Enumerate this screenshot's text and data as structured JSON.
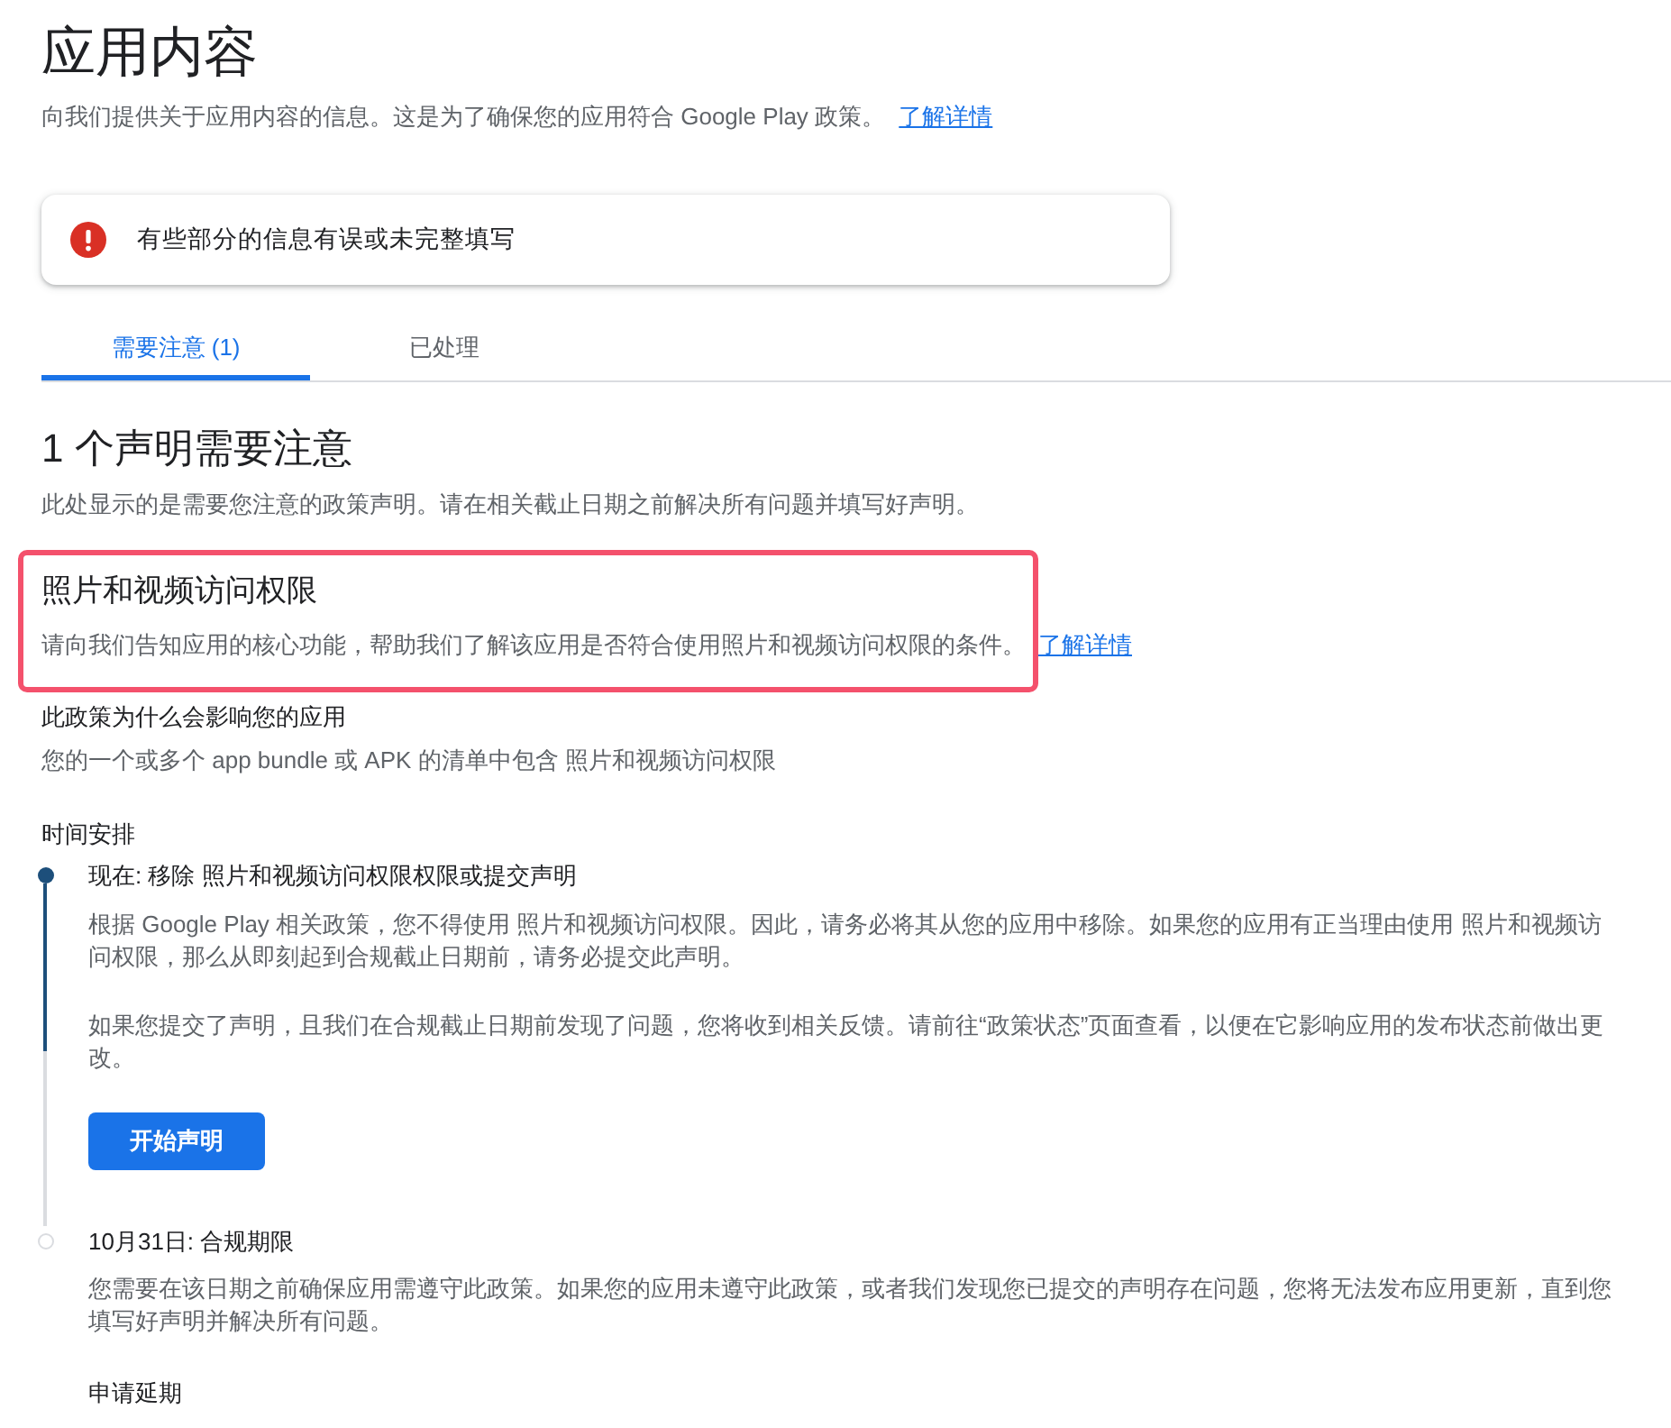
{
  "page": {
    "title": "应用内容",
    "subtitle": "向我们提供关于应用内容的信息。这是为了确保您的应用符合 Google Play 政策。",
    "subtitle_link": "了解详情"
  },
  "alert": {
    "kind": "error",
    "message": "有些部分的信息有误或未完整填写"
  },
  "tabs": [
    {
      "label": "需要注意 (1)",
      "selected": true
    },
    {
      "label": "已处理",
      "selected": false
    }
  ],
  "section": {
    "heading": "1 个声明需要注意",
    "description": "此处显示的是需要您注意的政策声明。请在相关截止日期之前解决所有问题并填写好声明。"
  },
  "declaration": {
    "title": "照片和视频访问权限",
    "description": "请向我们告知应用的核心功能，帮助我们了解该应用是否符合使用照片和视频访问权限的条件。",
    "link": "了解详情",
    "highlighted": true
  },
  "policy_impact": {
    "heading": "此政策为什么会影响您的应用",
    "text": "您的一个或多个 app bundle 或 APK 的清单中包含 照片和视频访问权限"
  },
  "timeline": {
    "heading": "时间安排",
    "items": [
      {
        "title": "现在: 移除 照片和视频访问权限权限或提交声明",
        "current": true,
        "paragraphs": [
          "根据 Google Play 相关政策，您不得使用 照片和视频访问权限。因此，请务必将其从您的应用中移除。如果您的应用有正当理由使用 照片和视频访问权限，那么从即刻起到合规截止日期前，请务必提交此声明。",
          "如果您提交了声明，且我们在合规截止日期前发现了问题，您将收到相关反馈。请前往“政策状态”页面查看，以便在它影响应用的发布状态前做出更改。"
        ],
        "button": "开始声明"
      },
      {
        "title": "10月31日: 合规期限",
        "current": false,
        "paragraphs": [
          "您需要在该日期之前确保应用需遵守此政策。如果您的应用未遵守此政策，或者我们发现您已提交的声明存在问题，您将无法发布应用更新，直到您填写好声明并解决所有问题。"
        ],
        "extra_heading": "申请延期"
      }
    ]
  }
}
